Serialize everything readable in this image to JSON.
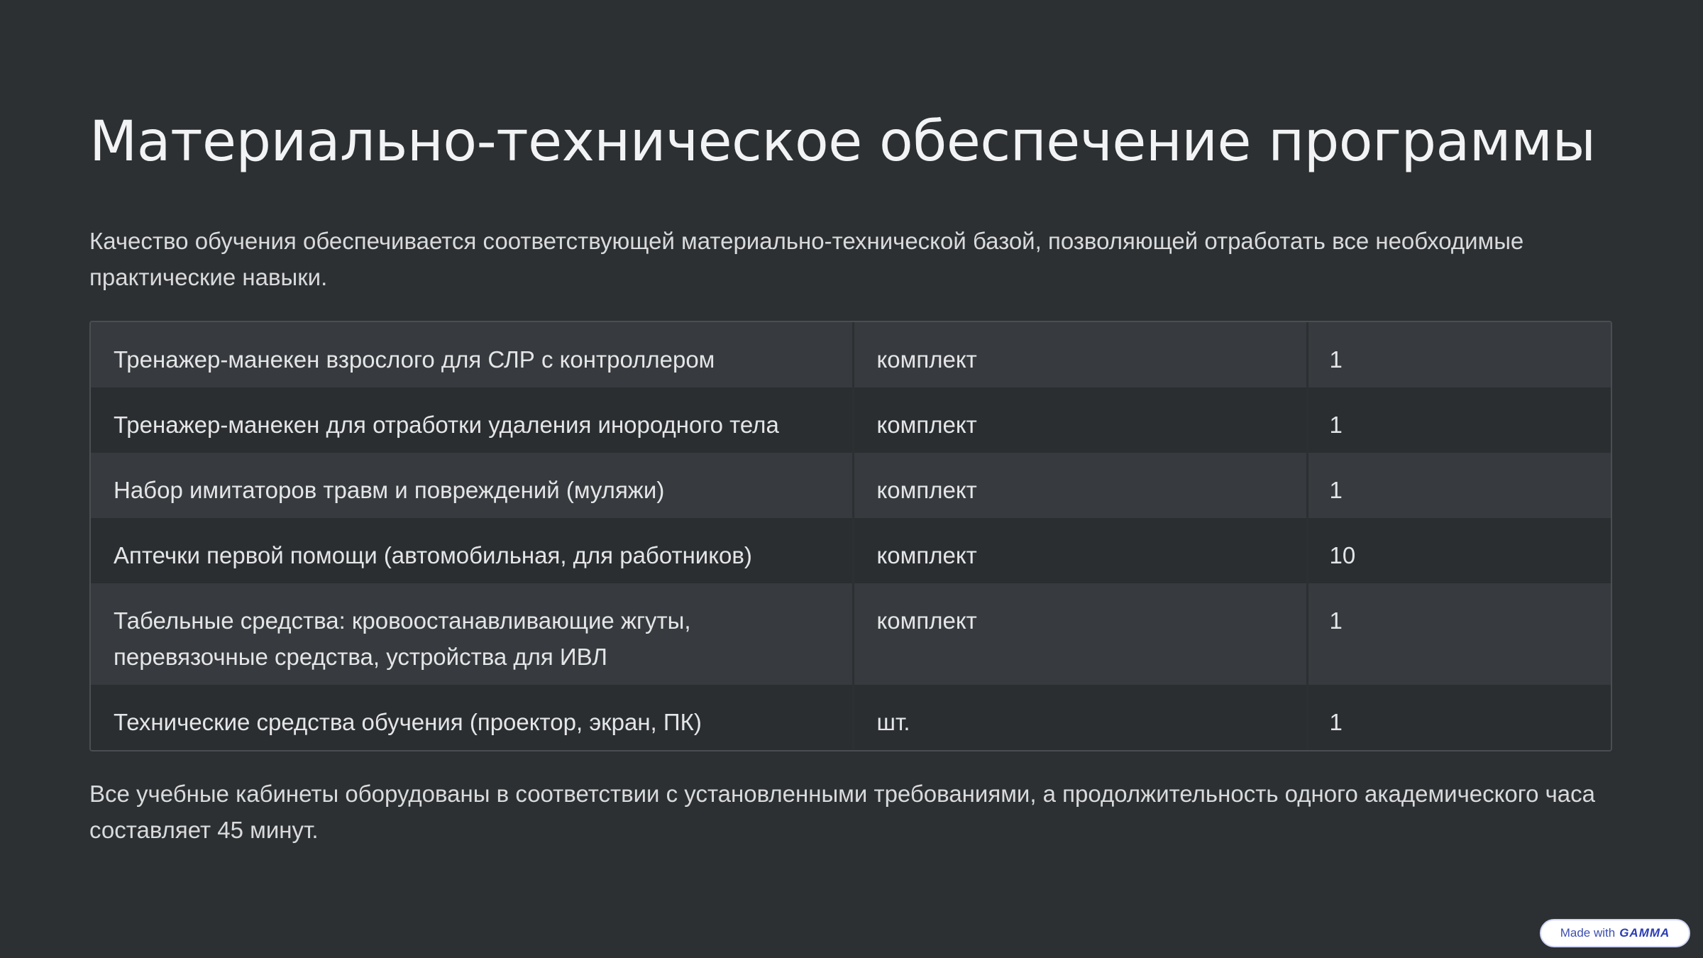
{
  "slide": {
    "title": "Материально-техническое обеспечение программы",
    "intro": "Качество обучения обеспечивается соответствующей материально-технической базой, позволяющей отработать все необходимые практические навыки.",
    "outro": "Все учебные кабинеты оборудованы в соответствии с установленными требованиями, а продолжительность одного академического часа составляет 45 минут."
  },
  "table": {
    "rows": [
      {
        "item": "Тренажер-манекен взрослого для СЛР с контроллером",
        "unit": "комплект",
        "qty": "1"
      },
      {
        "item": "Тренажер-манекен для отработки удаления инородного тела",
        "unit": "комплект",
        "qty": "1"
      },
      {
        "item": "Набор имитаторов травм и повреждений (муляжи)",
        "unit": "комплект",
        "qty": "1"
      },
      {
        "item": "Аптечки первой помощи (автомобильная, для работников)",
        "unit": "комплект",
        "qty": "10"
      },
      {
        "item": "Табельные средства: кровоостанавливающие жгуты, перевязочные средства, устройства для ИВЛ",
        "unit": "комплект",
        "qty": "1"
      },
      {
        "item": "Технические средства обучения (проектор, экран, ПК)",
        "unit": "шт.",
        "qty": "1"
      }
    ]
  },
  "badge": {
    "prefix": "Made with",
    "brand": "GAMMA"
  },
  "colors": {
    "background": "#2d3032",
    "row_light": "#373a3e",
    "row_dark": "#2b2e31",
    "text": "#e6e7e8"
  }
}
